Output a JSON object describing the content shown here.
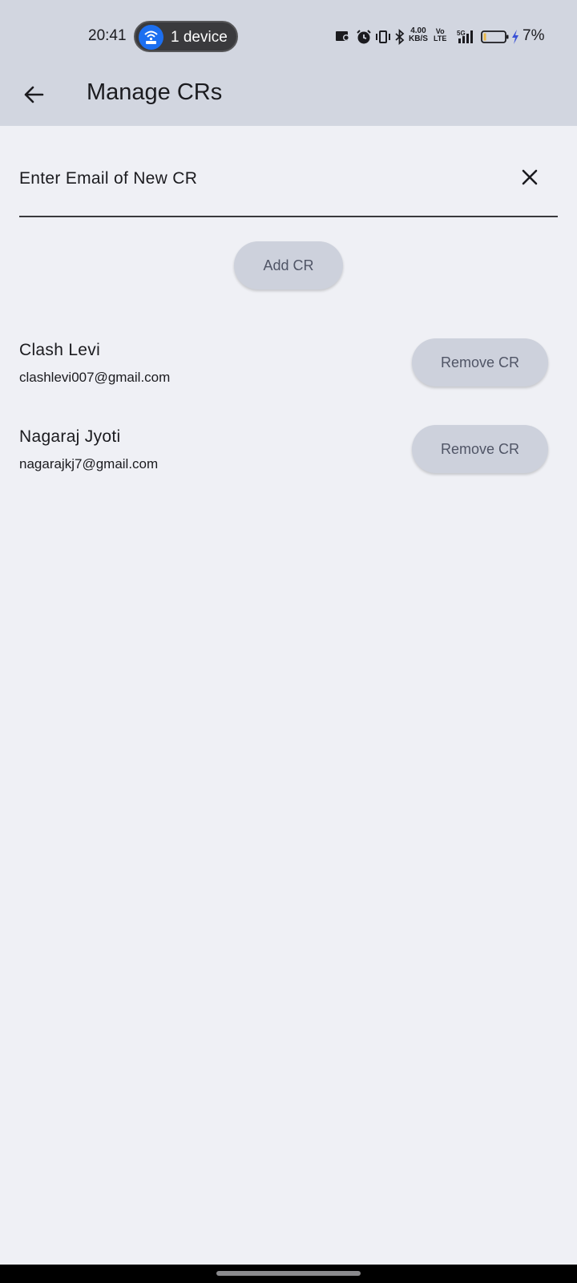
{
  "status_bar": {
    "time": "20:41",
    "hotspot_label": "1 device",
    "net_speed_value": "4.00",
    "net_speed_unit": "KB/S",
    "volte_top": "Vo",
    "volte_bottom": "LTE",
    "network_type": "5G",
    "battery_percent": "7%",
    "colors": {
      "background": "#d2d6e0",
      "hotspot_accent": "#1c6ff0",
      "charging_bolt": "#3b52d6"
    }
  },
  "app_bar": {
    "title": "Manage CRs",
    "back_icon": "arrow-left-icon"
  },
  "form": {
    "email_placeholder": "Enter Email of New CR",
    "email_value": "",
    "clear_icon": "close-icon",
    "add_button_label": "Add CR"
  },
  "crs": [
    {
      "name": "Clash Levi",
      "email": "clashlevi007@gmail.com",
      "remove_label": "Remove CR"
    },
    {
      "name": "Nagaraj Jyoti",
      "email": "nagarajkj7@gmail.com",
      "remove_label": "Remove CR"
    }
  ],
  "theme": {
    "page_background": "#eff0f5",
    "button_background": "#cdd1dc",
    "button_text": "#505566"
  }
}
